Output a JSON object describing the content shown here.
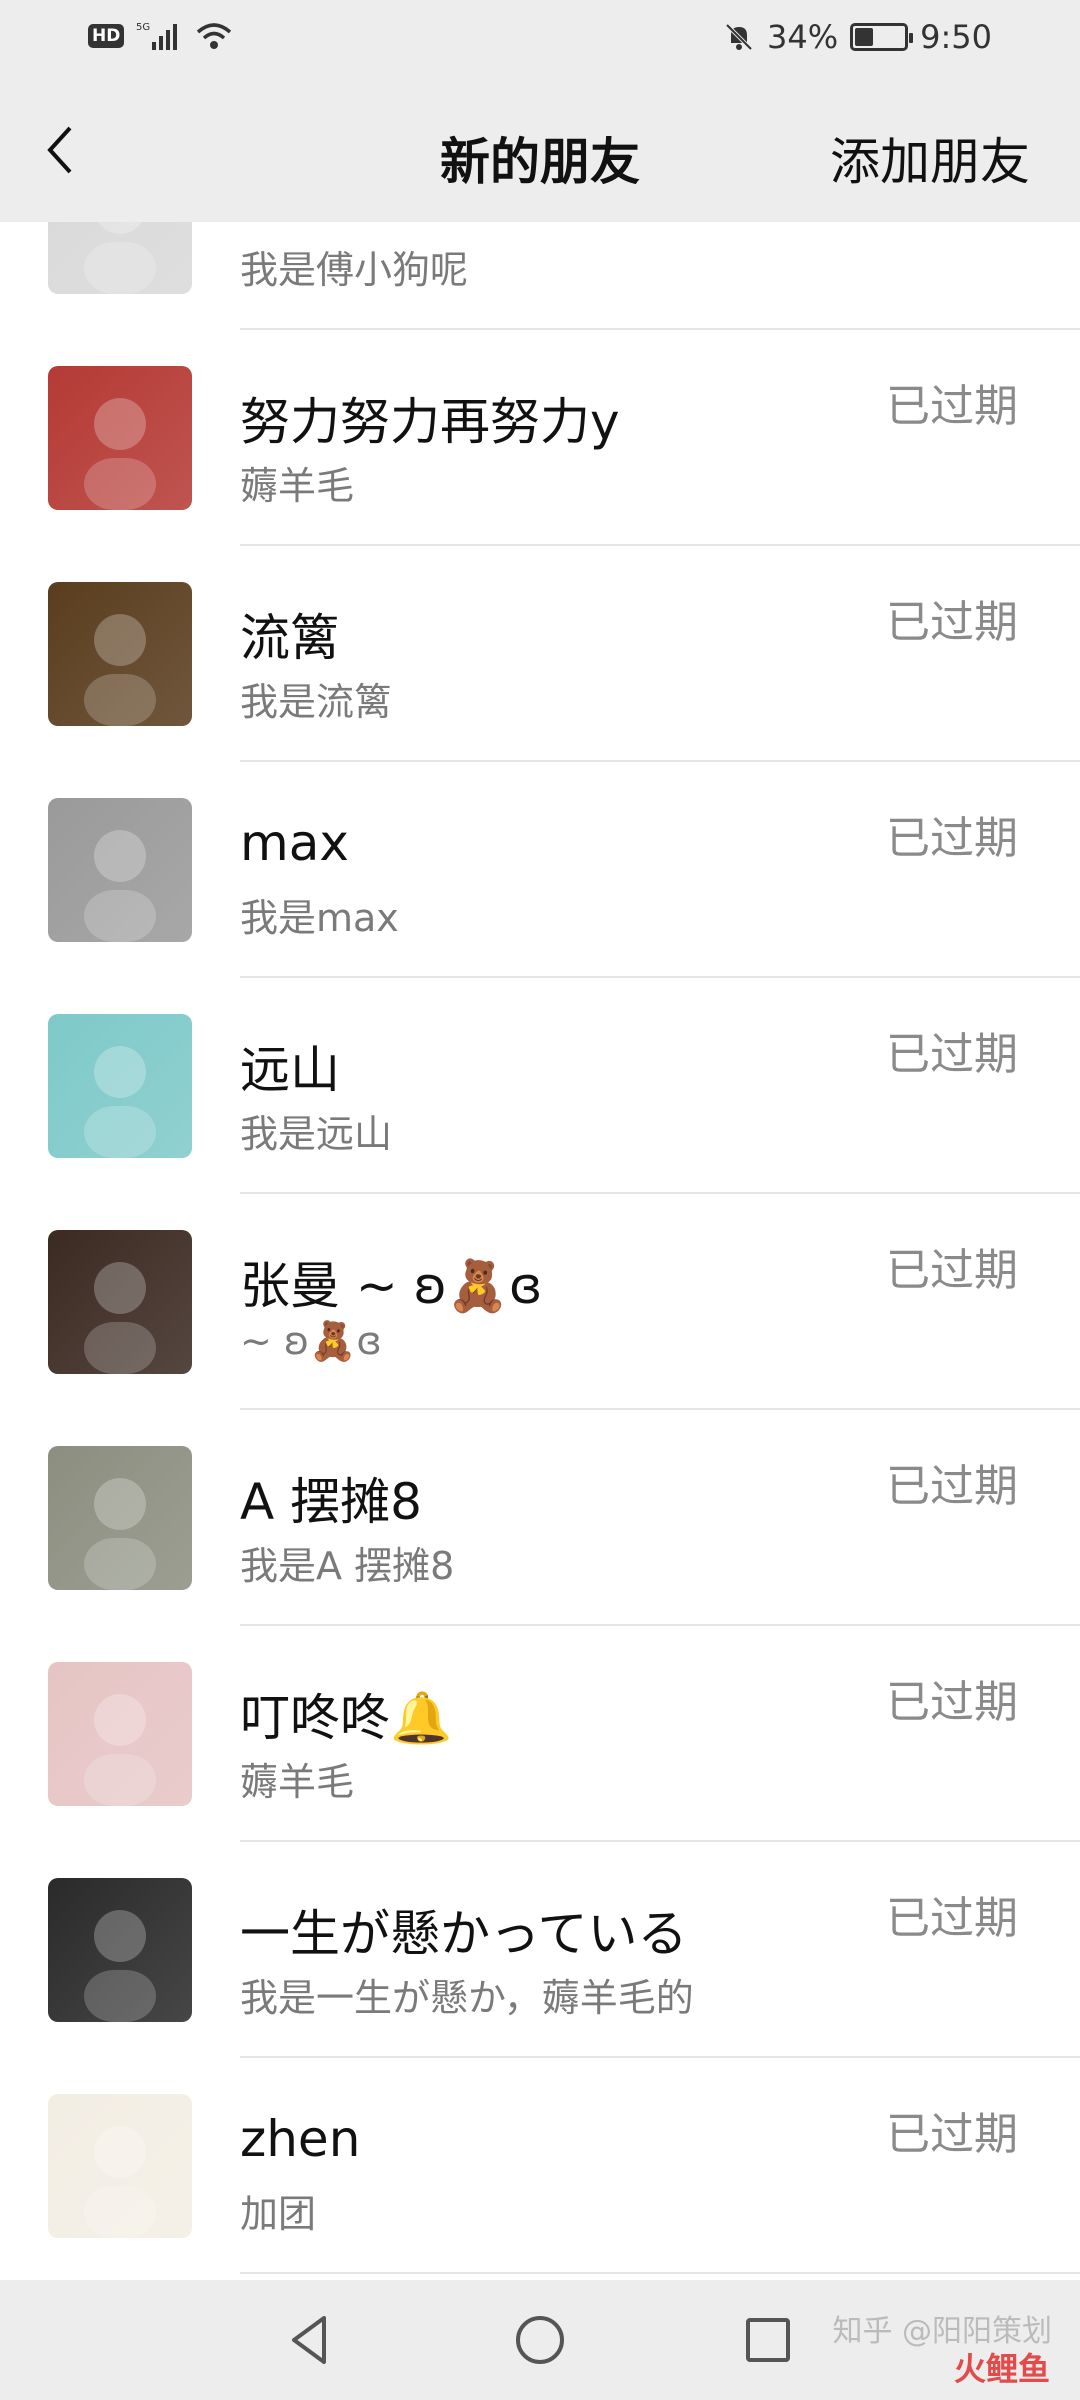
{
  "status_bar": {
    "hd": "HD",
    "network": "5G",
    "battery_text": "34%",
    "battery_level": 0.34,
    "time": "9:50"
  },
  "nav": {
    "title": "新的朋友",
    "add_friend": "添加朋友"
  },
  "friends": [
    {
      "name": "",
      "sub": "我是傅小狗呢",
      "status": "",
      "avatar_icon": "sketch-portrait-avatar",
      "avatar_color": "#d9d9d9"
    },
    {
      "name": "努力努力再努力y",
      "sub": "薅羊毛",
      "status": "已过期",
      "avatar_icon": "couple-photo-avatar",
      "avatar_color": "#b53a35"
    },
    {
      "name": "流篱",
      "sub": "我是流篱",
      "status": "已过期",
      "avatar_icon": "squirrel-avatar",
      "avatar_color": "#5a3d1e"
    },
    {
      "name": "max",
      "sub": "我是max",
      "status": "已过期",
      "avatar_icon": "rabbit-toy-avatar",
      "avatar_color": "#9a9a9a"
    },
    {
      "name": "远山",
      "sub": "我是远山",
      "status": "已过期",
      "avatar_icon": "water-droplet-avatar",
      "avatar_color": "#7fc9c9"
    },
    {
      "name": "张曼 ~ ʚ🧸ɞ",
      "sub": "~ ʚ🧸ɞ",
      "status": "已过期",
      "avatar_icon": "girl-sunflower-avatar",
      "avatar_color": "#3b2a22"
    },
    {
      "name": "A 摆摊8",
      "sub": "我是A 摆摊8",
      "status": "已过期",
      "avatar_icon": "green-toy-avatar",
      "avatar_color": "#8c8f80"
    },
    {
      "name": "叮咚咚🔔",
      "sub": "薅羊毛",
      "status": "已过期",
      "avatar_icon": "paw-avatar",
      "avatar_color": "#e6c4c4"
    },
    {
      "name": "一生が懸かっている",
      "sub": "我是一生が懸か，薅羊毛的",
      "status": "已过期",
      "avatar_icon": "cartoon-girl-avatar",
      "avatar_color": "#2a2a2a"
    },
    {
      "name": "zhen",
      "sub": "加团",
      "status": "已过期",
      "avatar_icon": "bird-flowers-avatar",
      "avatar_color": "#f3eee4"
    }
  ],
  "watermark": "知乎 @阳阳策划",
  "watermark_mark": "火鲤鱼"
}
